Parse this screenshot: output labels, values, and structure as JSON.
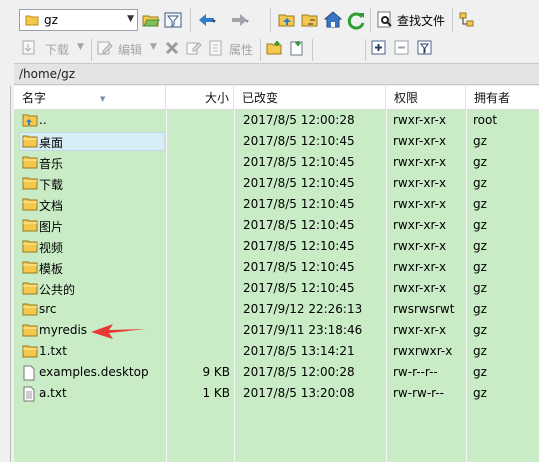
{
  "toolbar": {
    "location_value": "gz",
    "find_files_label": "查找文件",
    "download_label": "下载",
    "edit_label": "编辑",
    "properties_label": "属性"
  },
  "path": "/home/gz",
  "columns": {
    "name": "名字",
    "size": "大小",
    "modified": "已改变",
    "permissions": "权限",
    "owner": "拥有者"
  },
  "files": [
    {
      "name": "..",
      "size": "",
      "modified": "2017/8/5 12:00:28",
      "permissions": "rwxr-xr-x",
      "owner": "root",
      "icon": "folder-up-icon"
    },
    {
      "name": "桌面",
      "size": "",
      "modified": "2017/8/5 12:10:45",
      "permissions": "rwxr-xr-x",
      "owner": "gz",
      "icon": "folder-icon",
      "selected": true
    },
    {
      "name": "音乐",
      "size": "",
      "modified": "2017/8/5 12:10:45",
      "permissions": "rwxr-xr-x",
      "owner": "gz",
      "icon": "folder-icon"
    },
    {
      "name": "下载",
      "size": "",
      "modified": "2017/8/5 12:10:45",
      "permissions": "rwxr-xr-x",
      "owner": "gz",
      "icon": "folder-icon"
    },
    {
      "name": "文档",
      "size": "",
      "modified": "2017/8/5 12:10:45",
      "permissions": "rwxr-xr-x",
      "owner": "gz",
      "icon": "folder-icon"
    },
    {
      "name": "图片",
      "size": "",
      "modified": "2017/8/5 12:10:45",
      "permissions": "rwxr-xr-x",
      "owner": "gz",
      "icon": "folder-icon"
    },
    {
      "name": "视频",
      "size": "",
      "modified": "2017/8/5 12:10:45",
      "permissions": "rwxr-xr-x",
      "owner": "gz",
      "icon": "folder-icon"
    },
    {
      "name": "模板",
      "size": "",
      "modified": "2017/8/5 12:10:45",
      "permissions": "rwxr-xr-x",
      "owner": "gz",
      "icon": "folder-icon"
    },
    {
      "name": "公共的",
      "size": "",
      "modified": "2017/8/5 12:10:45",
      "permissions": "rwxr-xr-x",
      "owner": "gz",
      "icon": "folder-icon"
    },
    {
      "name": "src",
      "size": "",
      "modified": "2017/9/12 22:26:13",
      "permissions": "rwsrwsrwt",
      "owner": "gz",
      "icon": "folder-icon"
    },
    {
      "name": "myredis",
      "size": "",
      "modified": "2017/9/11 23:18:46",
      "permissions": "rwxr-xr-x",
      "owner": "gz",
      "icon": "folder-icon"
    },
    {
      "name": "1.txt",
      "size": "",
      "modified": "2017/8/5 13:14:21",
      "permissions": "rwxrwxr-x",
      "owner": "gz",
      "icon": "folder-icon"
    },
    {
      "name": "examples.desktop",
      "size": "9 KB",
      "modified": "2017/8/5 12:00:28",
      "permissions": "rw-r--r--",
      "owner": "gz",
      "icon": "file-icon"
    },
    {
      "name": "a.txt",
      "size": "1 KB",
      "modified": "2017/8/5 13:20:08",
      "permissions": "rw-rw-r--",
      "owner": "gz",
      "icon": "text-file-icon"
    }
  ],
  "colors": {
    "list_background": "#c9ecc6",
    "folder": "#f4c84c",
    "annotation_arrow": "#e83a35",
    "toolbar_blue": "#2f7cc9",
    "toolbar_green": "#2e9d33"
  }
}
